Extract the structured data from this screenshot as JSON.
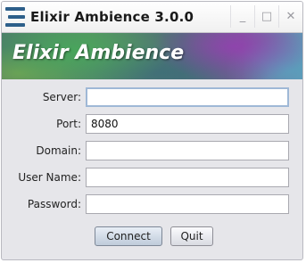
{
  "window": {
    "title": "Elixir Ambience 3.0.0",
    "controls": {
      "minimize": "_",
      "maximize": "□",
      "close": "✕"
    }
  },
  "banner": {
    "title": "Elixir Ambience"
  },
  "form": {
    "server": {
      "label": "Server:",
      "value": "",
      "placeholder": ""
    },
    "port": {
      "label": "Port:",
      "value": "8080",
      "placeholder": ""
    },
    "domain": {
      "label": "Domain:",
      "value": "",
      "placeholder": ""
    },
    "username": {
      "label": "User Name:",
      "value": "",
      "placeholder": ""
    },
    "password": {
      "label": "Password:",
      "value": "",
      "placeholder": ""
    }
  },
  "buttons": {
    "connect": "Connect",
    "quit": "Quit"
  },
  "colors": {
    "accent_icon": "#2d5f8a",
    "focus_border": "#9fb8d6"
  }
}
